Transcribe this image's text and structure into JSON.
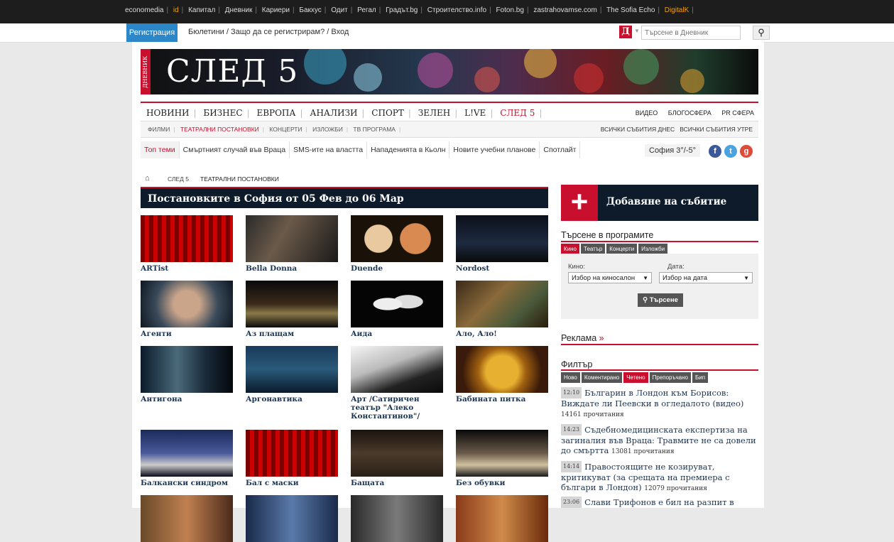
{
  "topbar": {
    "links": [
      "economedia",
      "id",
      "Капитал",
      "Дневник",
      "Кариери",
      "Бакхус",
      "Одит",
      "Регал",
      "Градът.bg",
      "Строителство.info",
      "Foton.bg",
      "zastrahovamse.com",
      "The Sofia Echo",
      "DigitalK"
    ]
  },
  "regbar": {
    "register_label": "Регистрация",
    "newsletters": "Бюлетини",
    "why_register": "Защо да се регистрирам?",
    "login": "Вход",
    "search_placeholder": "Търсене в Дневник",
    "logo_letter": "Д"
  },
  "banner": {
    "side_text": "ДНЕВНИК",
    "title": "СЛЕД 5"
  },
  "mainnav": {
    "items": [
      "НОВИНИ",
      "БИЗНЕС",
      "ЕВРОПА",
      "АНАЛИЗИ",
      "СПОРТ",
      "ЗЕЛЕН",
      "L!VE",
      "СЛЕД 5"
    ],
    "right": [
      "ВИДЕО",
      "БЛОГОСФЕРА",
      "PR СФЕРА"
    ]
  },
  "subnav": {
    "items": [
      "ФИЛМИ",
      "ТЕАТРАЛНИ ПОСТАНОВКИ",
      "КОНЦЕРТИ",
      "ИЗЛОЖБИ",
      "ТВ ПРОГРАМА"
    ],
    "right": [
      "ВСИЧКИ СЪБИТИЯ ДНЕС",
      "ВСИЧКИ СЪБИТИЯ УТРЕ"
    ]
  },
  "topics": {
    "items": [
      "Топ теми",
      "Смъртният случай във Враца",
      "SMS-ите на властта",
      "Нападенията в Кьолн",
      "Новите учебни планове",
      "Спотлайт"
    ]
  },
  "weather": "София 3°/-5°",
  "breadcrumb": [
    "СЛЕД 5",
    "ТЕАТРАЛНИ ПОСТАНОВКИ"
  ],
  "heading": "Постановките в София от 05 Фев до 06 Мар",
  "shows": [
    {
      "title": "ARTist"
    },
    {
      "title": "Bella Donna"
    },
    {
      "title": "Duende"
    },
    {
      "title": "Nordost"
    },
    {
      "title": "Агенти"
    },
    {
      "title": "Аз плащам"
    },
    {
      "title": "Аида"
    },
    {
      "title": "Ало, Ало!"
    },
    {
      "title": "Антигона"
    },
    {
      "title": "Аргонавтика"
    },
    {
      "title": "Арт /Сатиричен театър \"Алеко Константинов\"/"
    },
    {
      "title": "Бабината питка"
    },
    {
      "title": "Балкански синдром"
    },
    {
      "title": "Бал с маски"
    },
    {
      "title": "Бащата"
    },
    {
      "title": "Без обувки"
    }
  ],
  "sidebar": {
    "add_event": "Добавяне на събитие",
    "search_title": "Търсене в програмите",
    "search_tabs": [
      "Кино",
      "Театър",
      "Концерти",
      "Изложби"
    ],
    "cinema_label": "Кино:",
    "cinema_value": "Избор на киносалон",
    "date_label": "Дата:",
    "date_value": "Избор на дата",
    "search_button": "Търсене",
    "ads_title": "Реклама",
    "filter_title": "Филтър",
    "filter_tabs": [
      "Ново",
      "Коментирано",
      "Четено",
      "Препоръчано",
      "Бип"
    ],
    "news": [
      {
        "time": "12:10",
        "text": "Българин в Лондон към Борисов: Виждате ли Пеевски в огледалото (видео)",
        "reads": "14161 прочитания"
      },
      {
        "time": "14:23",
        "text": "Съдебномедицинската експертиза на загиналия във Враца: Травмите не са довели до смъртта",
        "reads": "13081 прочитания"
      },
      {
        "time": "14:14",
        "text": "Правостоящите не козируват, критикуват (за срещата на премиера с българи в Лондон)",
        "reads": "12079 прочитания"
      },
      {
        "time": "23:06",
        "text": "Слави Трифонов е бил на разпит в",
        "reads": ""
      }
    ]
  },
  "colors": {
    "accent": "#c8102e",
    "dark": "#0e1b2a",
    "link": "#1e3552"
  }
}
